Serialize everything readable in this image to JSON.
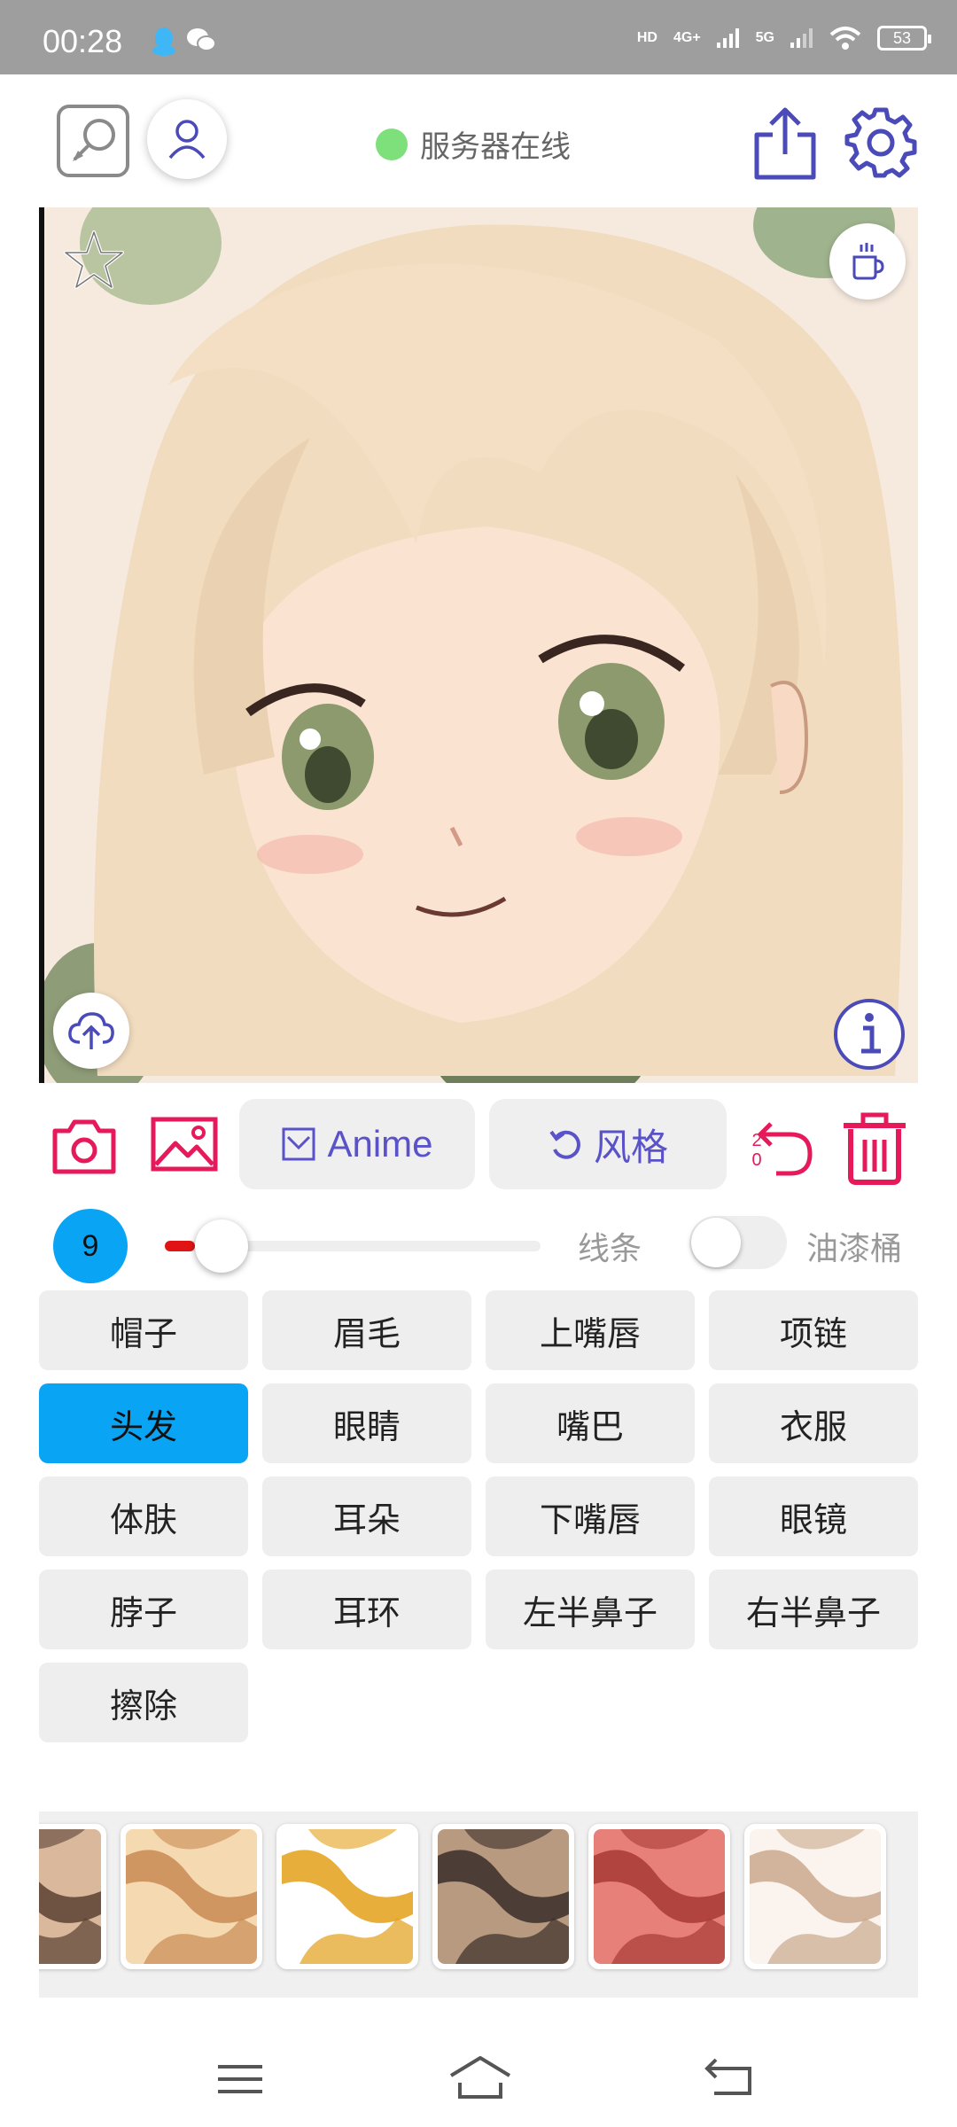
{
  "status_bar": {
    "time": "00:28",
    "network_labels": [
      "HD",
      "4G+",
      "5G"
    ],
    "battery": "53"
  },
  "header": {
    "server_status": "服务器在线",
    "server_status_color": "#7de07a",
    "icons": [
      "edit-icon",
      "user-icon",
      "share-icon",
      "gear-icon"
    ]
  },
  "canvas": {
    "icons": [
      "star-icon",
      "coffee-icon",
      "cloud-upload-icon",
      "info-icon"
    ]
  },
  "actions": {
    "anime_label": "Anime",
    "style_label": "风格",
    "undo_count_top": "2",
    "undo_count_bottom": "0",
    "icons": [
      "camera-icon",
      "image-icon",
      "undo-icon",
      "trash-icon"
    ]
  },
  "brush": {
    "size": "9",
    "slider_value": 0.08,
    "lines_label": "线条",
    "bucket_label": "油漆桶",
    "bucket_enabled": false
  },
  "parts": [
    {
      "label": "帽子",
      "active": false
    },
    {
      "label": "眉毛",
      "active": false
    },
    {
      "label": "上嘴唇",
      "active": false
    },
    {
      "label": "项链",
      "active": false
    },
    {
      "label": "头发",
      "active": true
    },
    {
      "label": "眼睛",
      "active": false
    },
    {
      "label": "嘴巴",
      "active": false
    },
    {
      "label": "衣服",
      "active": false
    },
    {
      "label": "体肤",
      "active": false
    },
    {
      "label": "耳朵",
      "active": false
    },
    {
      "label": "下嘴唇",
      "active": false
    },
    {
      "label": "眼镜",
      "active": false
    },
    {
      "label": "脖子",
      "active": false
    },
    {
      "label": "耳环",
      "active": false
    },
    {
      "label": "左半鼻子",
      "active": false
    },
    {
      "label": "右半鼻子",
      "active": false
    },
    {
      "label": "擦除",
      "active": false
    }
  ],
  "textures": [
    {
      "base": "#d9b89c",
      "accent": "#5a4033"
    },
    {
      "base": "#f5d9b0",
      "accent": "#c98a55"
    },
    {
      "base": "#ffffff",
      "accent": "#e3a019"
    },
    {
      "base": "#b89a80",
      "accent": "#3a2d2a"
    },
    {
      "base": "#e8807a",
      "accent": "#a83a36"
    },
    {
      "base": "#fbf4ee",
      "accent": "#c9a88c"
    }
  ],
  "theme": {
    "accent": "#5a52c9",
    "danger": "#e6195a",
    "selected": "#0aa4f5"
  }
}
